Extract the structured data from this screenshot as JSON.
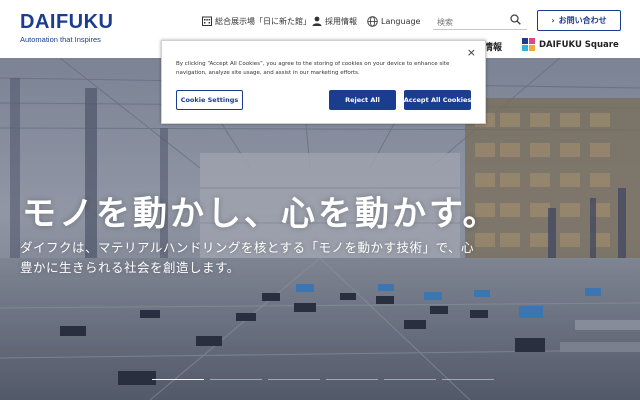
{
  "header": {
    "logo_text": "DAIFUKU",
    "logo_tagline": "Automation that Inspires",
    "showroom_link": "総合展示場「日に新た館」",
    "recruit_link": "採用情報",
    "language_label": "Language",
    "search_placeholder": "検索",
    "contact_button": "お問い合わせ",
    "nav_partial": "情報",
    "square_link": "DAIFUKU Square"
  },
  "hero": {
    "title": "モノを動かし、心を動かす。",
    "subtitle": "ダイフクは、マテリアルハンドリングを核とする「モノを動かす技術」で、心豊かに生きられる社会を創造します。",
    "indicator_count": 6,
    "active_indicator": 1
  },
  "cookie_dialog": {
    "text": "By clicking “Accept All Cookies”, you agree to the storing of cookies on your device to enhance site navigation, analyze site usage, and assist in our marketing efforts.",
    "settings_button": "Cookie Settings",
    "reject_button": "Reject All",
    "accept_button": "Accept All Cookies",
    "close_symbol": "×"
  },
  "colors": {
    "brand": "#1b3d8f",
    "hero_tint": "#7f8a99"
  },
  "icons": {
    "showroom": "building-icon",
    "recruit": "person-icon",
    "language": "globe-icon",
    "search": "search-icon",
    "contact": "chevron-right-icon",
    "square": "square-logo-icon",
    "close": "close-icon"
  }
}
